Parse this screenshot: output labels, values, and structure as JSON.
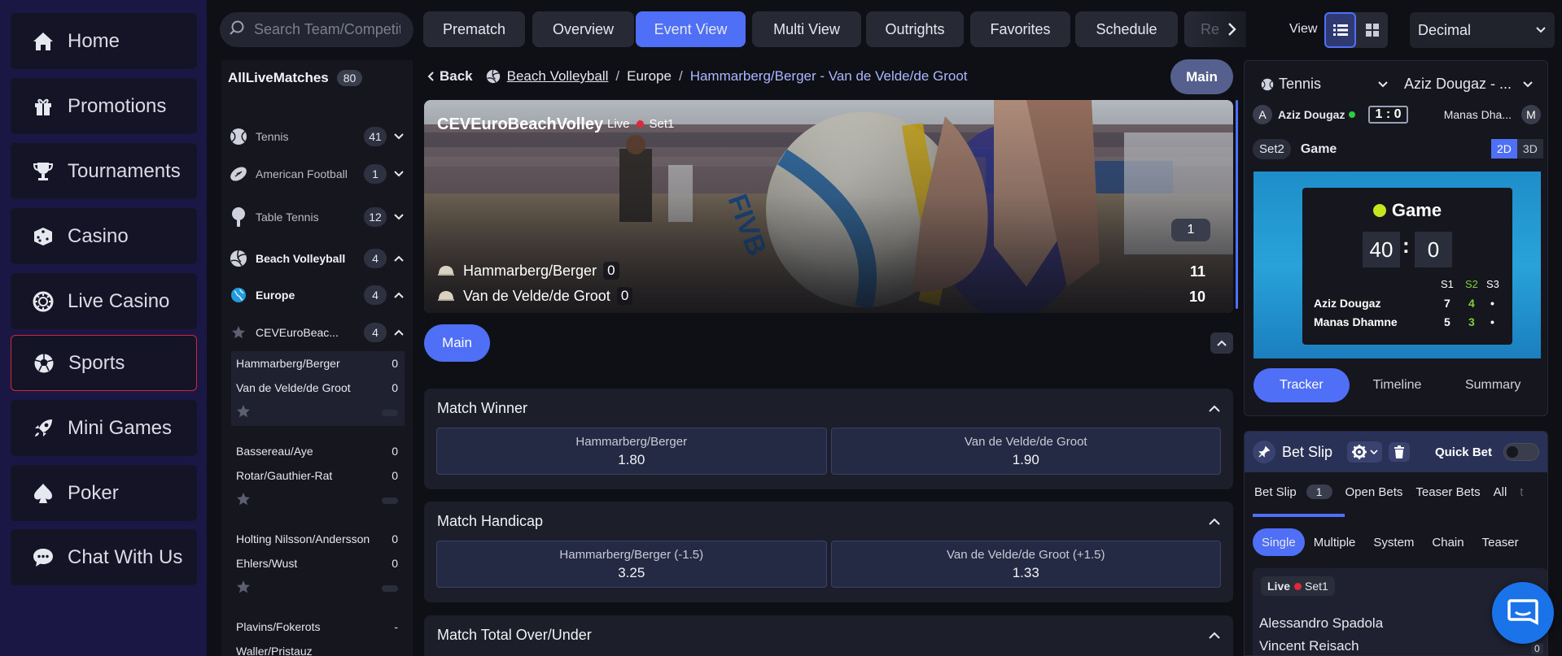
{
  "sidebar": {
    "items": [
      {
        "label": "Home",
        "icon": "home-icon"
      },
      {
        "label": "Promotions",
        "icon": "gift-icon"
      },
      {
        "label": "Tournaments",
        "icon": "trophy-icon"
      },
      {
        "label": "Casino",
        "icon": "dice-icon"
      },
      {
        "label": "Live Casino",
        "icon": "chip-icon"
      },
      {
        "label": "Sports",
        "icon": "soccer-ball-icon",
        "active": true
      },
      {
        "label": "Mini Games",
        "icon": "rocket-icon"
      },
      {
        "label": "Poker",
        "icon": "spade-icon"
      },
      {
        "label": "Chat With Us",
        "icon": "chat-bubble-icon"
      }
    ]
  },
  "topbar": {
    "search_placeholder": "Search Team/Competition",
    "tabs": [
      "Prematch",
      "Overview",
      "Event View",
      "Multi View",
      "Outrights",
      "Favorites",
      "Schedule"
    ],
    "tab_partial": "Re",
    "active_tab": "Event View",
    "view_label": "View",
    "odds_format": "Decimal"
  },
  "matchlist": {
    "title": "AllLiveMatches",
    "total": "80",
    "sports": [
      {
        "name": "Tennis",
        "count": "41"
      },
      {
        "name": "American Football",
        "count": "1"
      },
      {
        "name": "Table Tennis",
        "count": "12"
      },
      {
        "name": "Beach Volleyball",
        "count": "4"
      }
    ],
    "region": {
      "name": "Europe",
      "count": "4"
    },
    "competition": {
      "name": "CEVEuroBeac...",
      "count": "4"
    },
    "matches": [
      {
        "team1": "Hammarberg/Berger",
        "score1": "0",
        "team2": "Van de Velde/de Groot",
        "score2": "0"
      },
      {
        "team1": "Bassereau/Aye",
        "score1": "0",
        "team2": "Rotar/Gauthier-Rat",
        "score2": "0"
      },
      {
        "team1": "Holting Nilsson/Andersson",
        "score1": "0",
        "team2": "Ehlers/Wust",
        "score2": "0"
      },
      {
        "team1": "Plavins/Fokerots",
        "score1": "-",
        "team2": "Waller/Pristauz",
        "score2": ""
      }
    ]
  },
  "breadcrumb": {
    "back": "Back",
    "sport": "Beach Volleyball",
    "region": "Europe",
    "event": "Hammarberg/Berger - Van de Velde/de Groot",
    "main": "Main"
  },
  "hero": {
    "competition": "CEVEuroBeachVolley",
    "live": "Live",
    "set": "Set1",
    "set_number": "1",
    "team1": "Hammarberg/Berger",
    "team1_sets": "0",
    "team1_points": "11",
    "team2": "Van de Velde/de Groot",
    "team2_sets": "0",
    "team2_points": "10"
  },
  "markets": {
    "main_tab": "Main",
    "list": [
      {
        "title": "Match Winner",
        "odds": [
          {
            "name": "Hammarberg/Berger",
            "value": "1.80"
          },
          {
            "name": "Van de Velde/de Groot",
            "value": "1.90"
          }
        ]
      },
      {
        "title": "Match Handicap",
        "odds": [
          {
            "name": "Hammarberg/Berger (-1.5)",
            "value": "3.25"
          },
          {
            "name": "Van de Velde/de Groot (+1.5)",
            "value": "1.33"
          }
        ]
      },
      {
        "title": "Match Total Over/Under",
        "odds": []
      }
    ]
  },
  "tracker": {
    "sport": "Tennis",
    "match": "Aziz Dougaz - ...",
    "player1": "Aziz Dougaz",
    "player1_initial": "A",
    "player2": "Manas Dhamne",
    "player2_short": "Manas Dha...",
    "player2_initial": "M",
    "score_left": "1",
    "score_sep": ":",
    "score_right": "0",
    "set_label": "Set2",
    "game_label": "Game",
    "mode_2d": "2D",
    "mode_3d": "3D",
    "card_title": "Game",
    "points1": "40",
    "points2": "0",
    "sets_headers": [
      "S1",
      "S2",
      "S3"
    ],
    "sets1": [
      "7",
      "4",
      "•"
    ],
    "sets2": [
      "5",
      "3",
      "•"
    ],
    "tabs": [
      "Tracker",
      "Timeline",
      "Summary"
    ]
  },
  "betslip": {
    "title": "Bet Slip",
    "quick_bet": "Quick Bet",
    "tabs": [
      "Bet Slip",
      "Open Bets",
      "Teaser Bets",
      "All"
    ],
    "tabs_partial": "t",
    "count": "1",
    "types": [
      "Single",
      "Multiple",
      "System",
      "Chain",
      "Teaser"
    ],
    "bet": {
      "live": "Live",
      "set": "Set1",
      "team1": "Alessandro Spadola",
      "team2": "Vincent Reisach",
      "count": "0"
    }
  },
  "colors": {
    "accent": "#4f6ff7",
    "live": "#e0283b",
    "sidebar": "#1a1745",
    "active_border": "#d2273a"
  }
}
